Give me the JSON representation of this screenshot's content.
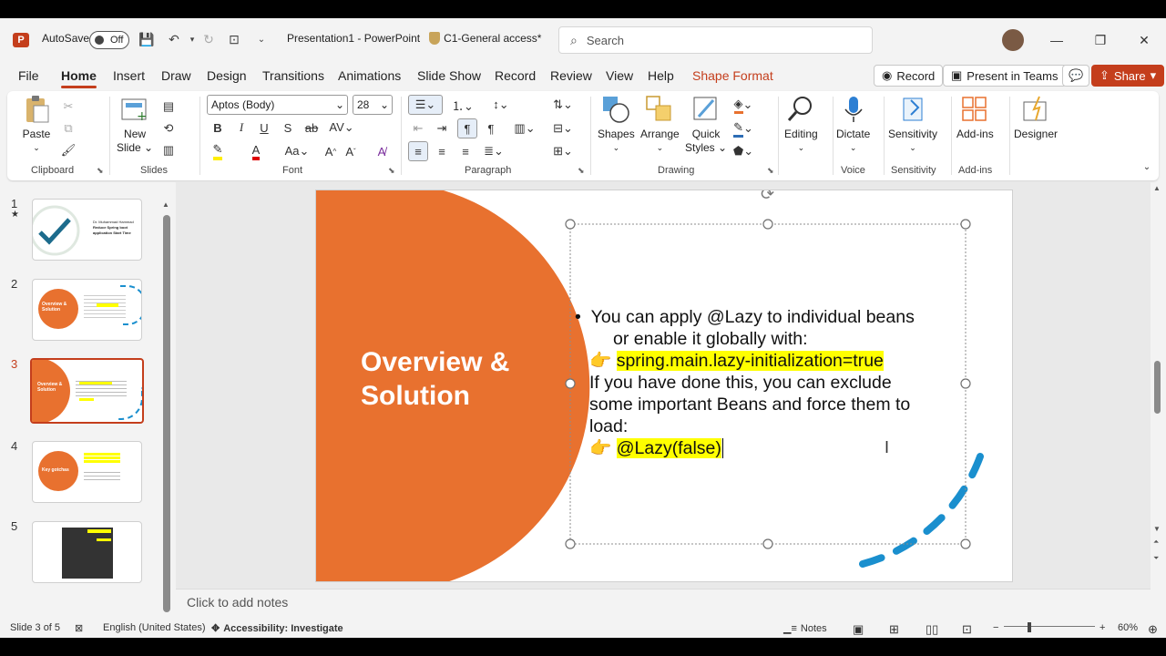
{
  "titlebar": {
    "autosave_label": "AutoSave",
    "autosave_state": "Off",
    "doc_title": "Presentation1  -  PowerPoint",
    "sensitivity_label": "C1-General access*",
    "search_placeholder": "Search"
  },
  "tabs": [
    "File",
    "Home",
    "Insert",
    "Draw",
    "Design",
    "Transitions",
    "Animations",
    "Slide Show",
    "Record",
    "Review",
    "View",
    "Help",
    "Shape Format"
  ],
  "tab_buttons": {
    "record": "Record",
    "present": "Present in Teams",
    "share": "Share"
  },
  "ribbon": {
    "clipboard": {
      "paste": "Paste",
      "group": "Clipboard"
    },
    "slides": {
      "new_slide_1": "New",
      "new_slide_2": "Slide",
      "group": "Slides"
    },
    "font": {
      "font_name": "Aptos (Body)",
      "font_size": "28",
      "group": "Font"
    },
    "paragraph": {
      "group": "Paragraph"
    },
    "drawing": {
      "shapes": "Shapes",
      "arrange": "Arrange",
      "quick_styles_1": "Quick",
      "quick_styles_2": "Styles",
      "group": "Drawing"
    },
    "editing": {
      "label": "Editing"
    },
    "voice": {
      "dictate": "Dictate",
      "group": "Voice"
    },
    "sensitivity": {
      "label": "Sensitivity",
      "group": "Sensitivity"
    },
    "addins": {
      "label": "Add-ins",
      "group": "Add-ins"
    },
    "designer": {
      "label": "Designer"
    }
  },
  "thumbnails": {
    "numbers": [
      "1",
      "2",
      "3",
      "4",
      "5"
    ],
    "t1_line1": "Dr. Muhammad Hammad",
    "t1_line2": "Reduce Spring boot",
    "t1_line3": "application Start Time",
    "t2_title": "Overview & Solution",
    "t3_title": "Overview & Solution",
    "t4_title": "Key gotchas"
  },
  "slide": {
    "title_line1": "Overview &",
    "title_line2": "Solution",
    "bullet_line1": "You can apply @Lazy to individual beans",
    "bullet_line2": "or enable it globally with:",
    "config": "spring.main.lazy-initialization=true",
    "line4": "If you have done this, you can exclude",
    "line5": "some important Beans and force them to",
    "line6": "load:",
    "annotation": "@Lazy(false)",
    "accent": "#e8712f",
    "highlight": "#ffff00",
    "circle": "#1a8fce"
  },
  "notes_placeholder": "Click to add notes",
  "status": {
    "slide_of": "Slide 3 of 5",
    "language": "English (United States)",
    "accessibility": "Accessibility: Investigate",
    "notes": "Notes",
    "zoom": "60%"
  }
}
